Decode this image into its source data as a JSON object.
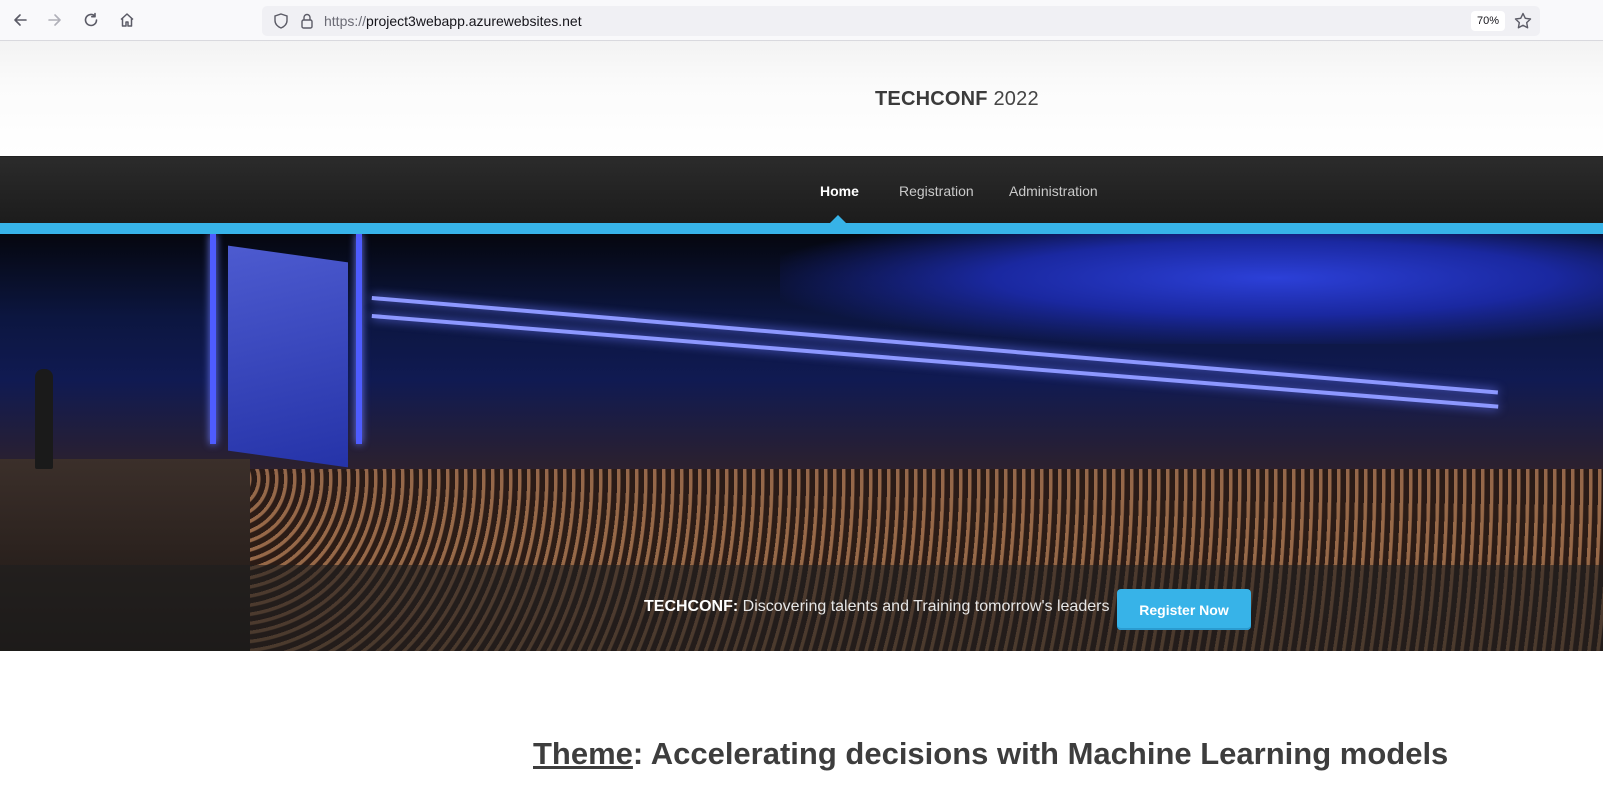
{
  "browser": {
    "url_prefix": "https://",
    "url_host": "project3webapp.azurewebsites.net",
    "zoom": "70%",
    "icons": [
      "back-arrow-icon",
      "forward-arrow-icon",
      "reload-icon",
      "home-icon",
      "shield-icon",
      "lock-icon",
      "star-icon"
    ]
  },
  "site": {
    "brand_bold": "TECHCONF",
    "brand_year": "2022"
  },
  "nav": {
    "items": [
      {
        "label": "Home",
        "active": true
      },
      {
        "label": "Registration",
        "active": false
      },
      {
        "label": "Administration",
        "active": false
      }
    ],
    "accent_color": "#37b3e8"
  },
  "hero": {
    "tagline_bold": "TECHCONF:",
    "tagline_text": " Discovering talents and Training tomorrow's leaders",
    "cta_label": "Register Now"
  },
  "content": {
    "theme_label": "Theme",
    "theme_text": ": Accelerating decisions with Machine Learning models"
  }
}
